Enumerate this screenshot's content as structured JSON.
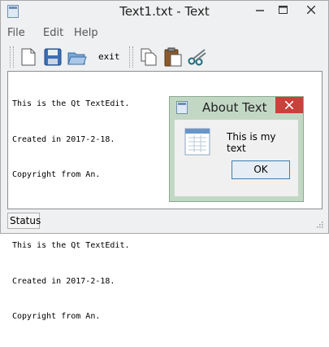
{
  "window": {
    "title": "Text1.txt - Text"
  },
  "menu": {
    "items": [
      "File",
      "Edit",
      "Help"
    ]
  },
  "toolbar": {
    "exit_label": "exit"
  },
  "editor": {
    "lines": [
      "This is the Qt TextEdit.",
      "Created in 2017-2-18.",
      "Copyright from An.",
      "",
      "This is the Qt TextEdit.",
      "Created in 2017-2-18.",
      "Copyright from An."
    ]
  },
  "status": {
    "text": "Status"
  },
  "dialog": {
    "title": "About Text",
    "message": "This is my text",
    "ok_label": "OK"
  },
  "colors": {
    "close_red": "#c8413b",
    "dialog_frame": "#c3d7c5",
    "ok_border": "#3c7fb1"
  }
}
